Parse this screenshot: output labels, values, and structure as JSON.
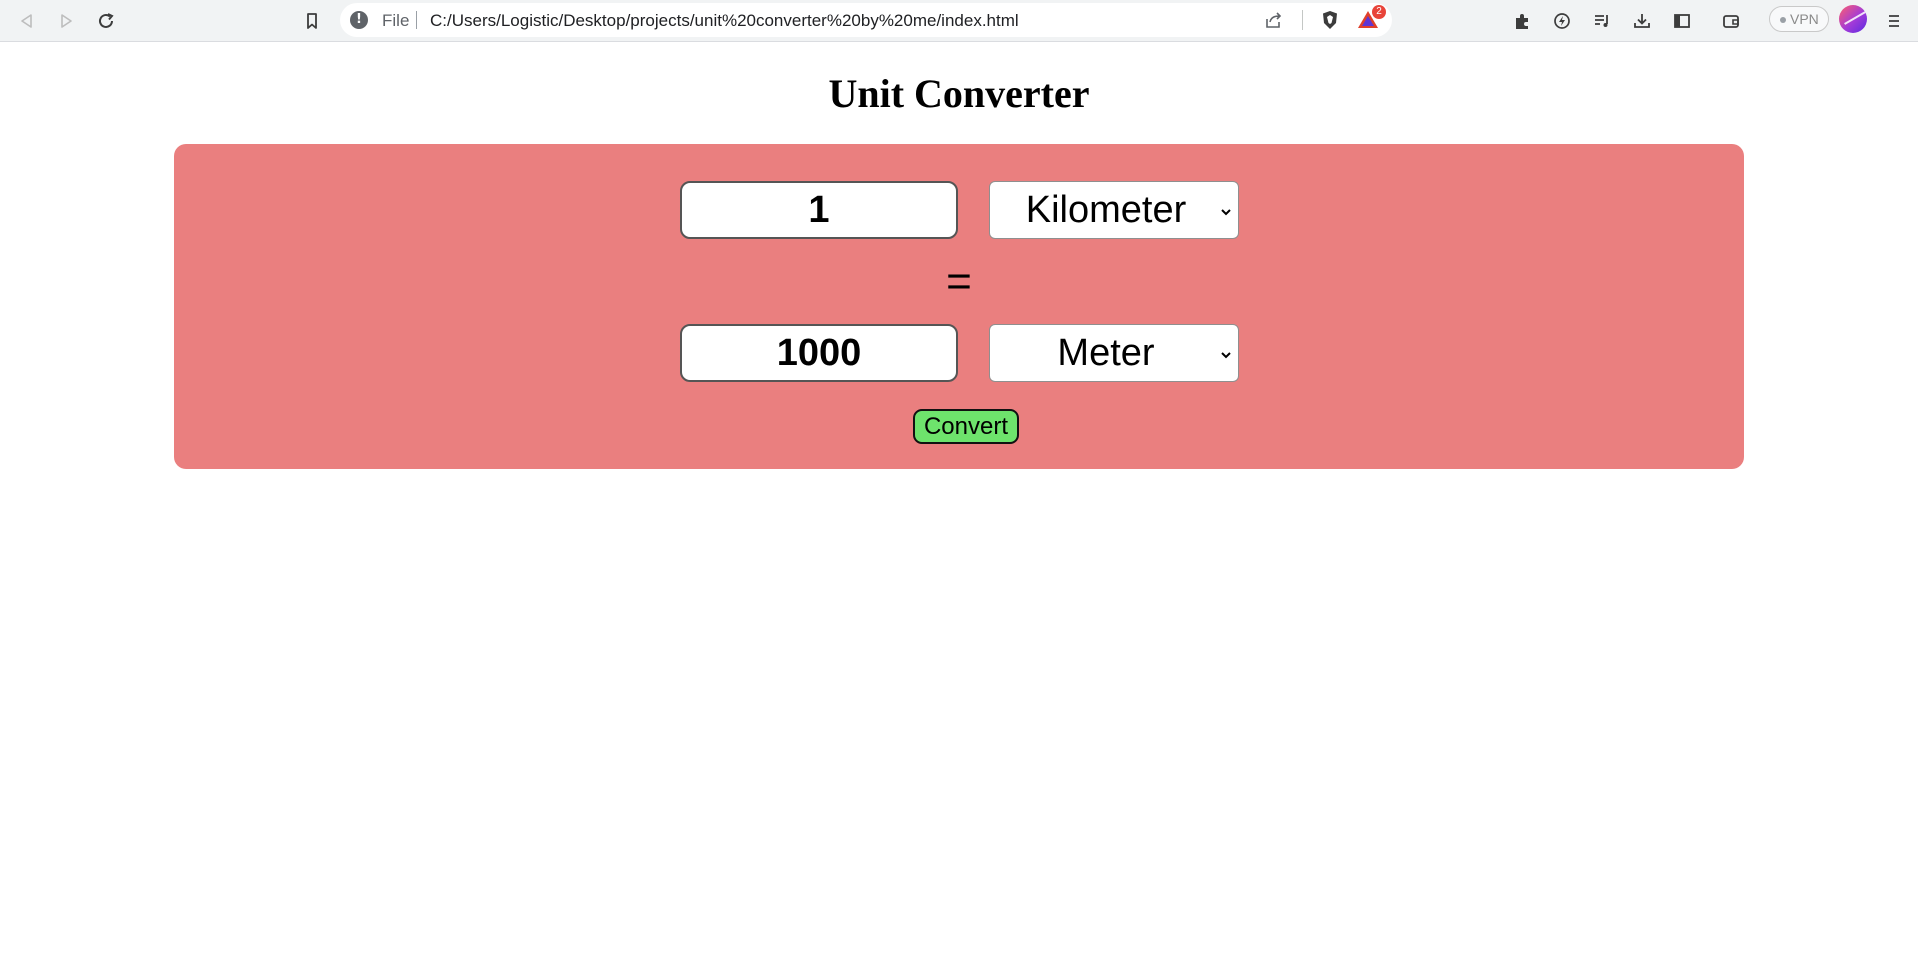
{
  "browser": {
    "url_scheme": "File",
    "url": "C:/Users/Logistic/Desktop/projects/unit%20converter%20by%20me/index.html",
    "rewards_badge": "2",
    "vpn_label": "VPN",
    "icons": [
      "back-icon",
      "forward-icon",
      "reload-icon",
      "bookmark-icon",
      "info-icon",
      "share-icon",
      "brave-shield-icon",
      "brave-rewards-icon",
      "extensions-icon",
      "leo-icon",
      "playlist-icon",
      "downloads-icon",
      "sidebar-icon",
      "wallet-icon",
      "avatar",
      "menu-icon"
    ]
  },
  "page": {
    "title": "Unit Converter"
  },
  "converter": {
    "from_value": "1",
    "from_unit": "Kilometer",
    "equals_sign": "=",
    "to_value": "1000",
    "to_unit": "Meter",
    "convert_label": "Convert",
    "colors": {
      "card_bg": "#ea7f7f",
      "button_bg": "#6ee36c"
    }
  }
}
